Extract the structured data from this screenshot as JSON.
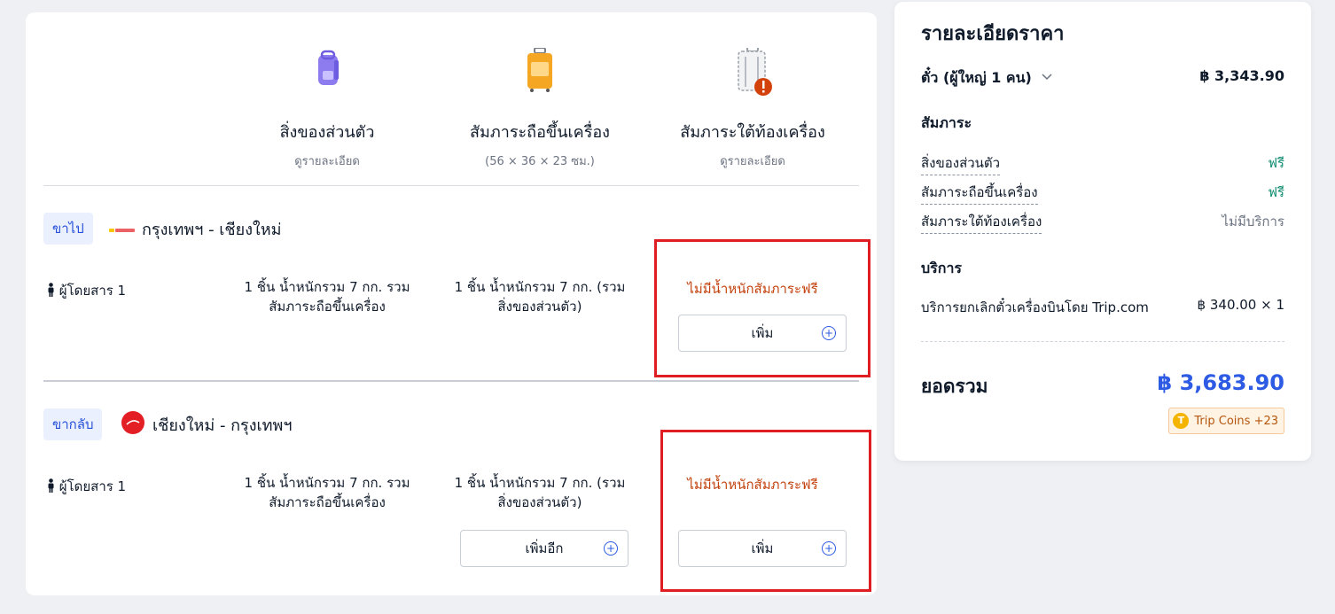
{
  "columns": [
    {
      "title": "สิ่งของส่วนตัว",
      "sub": "ดูรายละเอียด",
      "icon": "backpack-icon"
    },
    {
      "title": "สัมภาระถือขึ้นเครื่อง",
      "sub": "(56 × 36 × 23 ซม.)",
      "icon": "carry-on-suitcase-icon"
    },
    {
      "title": "สัมภาระใต้ท้องเครื่อง",
      "sub": "ดูรายละเอียด",
      "icon": "checked-baggage-warning-icon"
    }
  ],
  "segments": [
    {
      "tag": "ขาไป",
      "airline_logo": "vietjet-logo",
      "route": "กรุงเทพฯ - เชียงใหม่",
      "passenger": "ผู้โดยสาร 1",
      "personal": "1 ชิ้น น้ำหนักรวม 7 กก. รวมสัมภาระถือขึ้นเครื่อง",
      "carry_on": "1 ชิ้น น้ำหนักรวม 7 กก. (รวมสิ่งของส่วนตัว)",
      "checked_status": "ไม่มีน้ำหนักสัมภาระฟรี",
      "checked_button": "เพิ่ม"
    },
    {
      "tag": "ขากลับ",
      "airline_logo": "airasia-logo",
      "route": "เชียงใหม่ - กรุงเทพฯ",
      "passenger": "ผู้โดยสาร 1",
      "personal": "1 ชิ้น น้ำหนักรวม 7 กก. รวมสัมภาระถือขึ้นเครื่อง",
      "carry_on": "1 ชิ้น น้ำหนักรวม 7 กก. (รวมสิ่งของส่วนตัว)",
      "carry_on_button": "เพิ่มอีก",
      "checked_status": "ไม่มีน้ำหนักสัมภาระฟรี",
      "checked_button": "เพิ่ม"
    }
  ],
  "summary": {
    "title": "รายละเอียดราคา",
    "ticket_label": "ตั๋ว (ผู้ใหญ่ 1 คน)",
    "ticket_price": "฿ 3,343.90",
    "baggage_heading": "สัมภาระ",
    "baggage_items": [
      {
        "label": "สิ่งของส่วนตัว",
        "value": "ฟรี"
      },
      {
        "label": "สัมภาระถือขึ้นเครื่อง",
        "value": "ฟรี"
      },
      {
        "label": "สัมภาระใต้ท้องเครื่อง",
        "value": "ไม่มีบริการ"
      }
    ],
    "service_heading": "บริการ",
    "service_label": "บริการยกเลิกตั๋วเครื่องบินโดย Trip.com",
    "service_value": "฿ 340.00 × 1",
    "total_label": "ยอดรวม",
    "total_value": "฿ 3,683.90",
    "coins": "Trip Coins +23",
    "coin_letter": "T"
  },
  "colors": {
    "accent": "#2d5be3",
    "free": "#0b8a6e",
    "warning": "#c2410c",
    "highlight": "#e11d24"
  }
}
